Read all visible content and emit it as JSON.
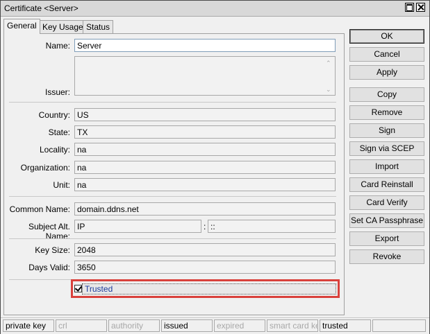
{
  "window": {
    "title": "Certificate <Server>"
  },
  "tabs": [
    {
      "label": "General",
      "active": true
    },
    {
      "label": "Key Usage",
      "active": false
    },
    {
      "label": "Status",
      "active": false
    }
  ],
  "form": {
    "name": {
      "label": "Name:",
      "value": "Server"
    },
    "issuer": {
      "label": "Issuer:",
      "value": ""
    },
    "country": {
      "label": "Country:",
      "value": "US"
    },
    "state": {
      "label": "State:",
      "value": "TX"
    },
    "locality": {
      "label": "Locality:",
      "value": "na"
    },
    "organization": {
      "label": "Organization:",
      "value": "na"
    },
    "unit": {
      "label": "Unit:",
      "value": "na"
    },
    "common_name": {
      "label": "Common Name:",
      "value": "domain.ddns.net"
    },
    "subject_alt_name": {
      "label": "Subject Alt. Name:",
      "type_value": "IP",
      "separator": ":",
      "value": "::"
    },
    "key_size": {
      "label": "Key Size:",
      "value": "2048"
    },
    "days_valid": {
      "label": "Days Valid:",
      "value": "3650"
    },
    "trusted": {
      "label": "Trusted",
      "checked": true,
      "highlight_color": "#d9413c"
    }
  },
  "buttons": {
    "ok": "OK",
    "cancel": "Cancel",
    "apply": "Apply",
    "copy": "Copy",
    "remove": "Remove",
    "sign": "Sign",
    "sign_via_scep": "Sign via SCEP",
    "import": "Import",
    "card_reinstall": "Card Reinstall",
    "card_verify": "Card Verify",
    "set_ca_passphrase": "Set CA Passphrase",
    "export": "Export",
    "revoke": "Revoke"
  },
  "status_bar": [
    {
      "label": "private key",
      "active": true
    },
    {
      "label": "crl",
      "active": false
    },
    {
      "label": "authority",
      "active": false
    },
    {
      "label": "issued",
      "active": true
    },
    {
      "label": "expired",
      "active": false
    },
    {
      "label": "smart card key",
      "active": false
    },
    {
      "label": "trusted",
      "active": true
    },
    {
      "label": "",
      "active": false
    }
  ],
  "icons": {
    "maximize": "maximize-icon",
    "close": "close-icon",
    "checkbox": "checkmark-icon"
  }
}
